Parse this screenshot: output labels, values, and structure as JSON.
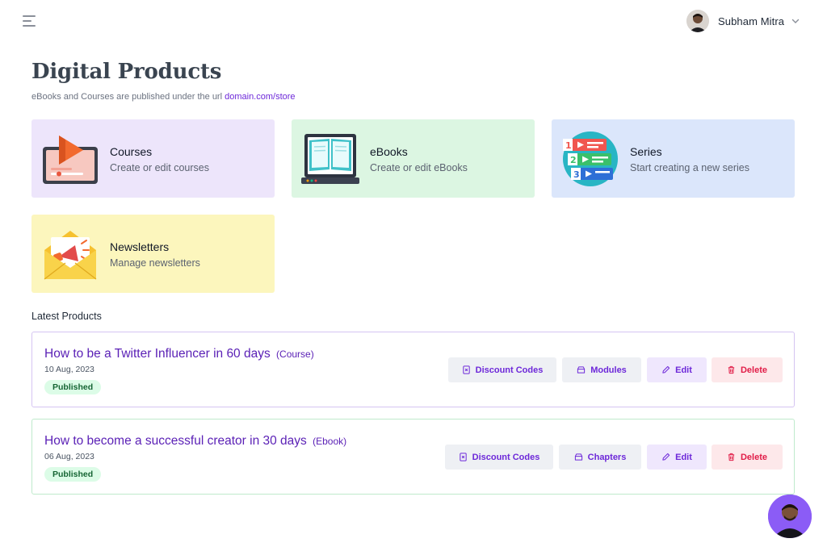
{
  "header": {
    "menu_icon": "hamburger-icon",
    "user_name": "Subham Mitra",
    "dropdown_icon": "chevron-down-icon"
  },
  "page": {
    "title": "Digital Products",
    "subtitle_text": "eBooks and Courses are published under the url ",
    "subtitle_link": "domain.com/store"
  },
  "cards": [
    {
      "title": "Courses",
      "description": "Create or edit courses",
      "icon": "video-laptop-icon",
      "color": "#ede5fb"
    },
    {
      "title": "eBooks",
      "description": "Create or edit eBooks",
      "icon": "open-book-laptop-icon",
      "color": "#dcf6e2"
    },
    {
      "title": "Series",
      "description": "Start creating a new series",
      "icon": "numbered-playlist-icon",
      "color": "#dbe6fb"
    },
    {
      "title": "Newsletters",
      "description": "Manage newsletters",
      "icon": "megaphone-envelope-icon",
      "color": "#fcf6bd"
    }
  ],
  "latest": {
    "label": "Latest Products",
    "products": [
      {
        "title": "How to be a Twitter Influencer in 60 days",
        "type": "(Course)",
        "date": "10 Aug, 2023",
        "status": "Published",
        "buttons": {
          "discount": "Discount Codes",
          "secondary": "Modules",
          "edit": "Edit",
          "delete": "Delete"
        }
      },
      {
        "title": "How to become a successful creator in 30 days",
        "type": "(Ebook)",
        "date": "06 Aug, 2023",
        "status": "Published",
        "buttons": {
          "discount": "Discount Codes",
          "secondary": "Chapters",
          "edit": "Edit",
          "delete": "Delete"
        }
      }
    ]
  },
  "colors": {
    "accent": "#6d28d9",
    "danger": "#e11d48",
    "success_bg": "#dcfce7",
    "success_text": "#166534"
  }
}
